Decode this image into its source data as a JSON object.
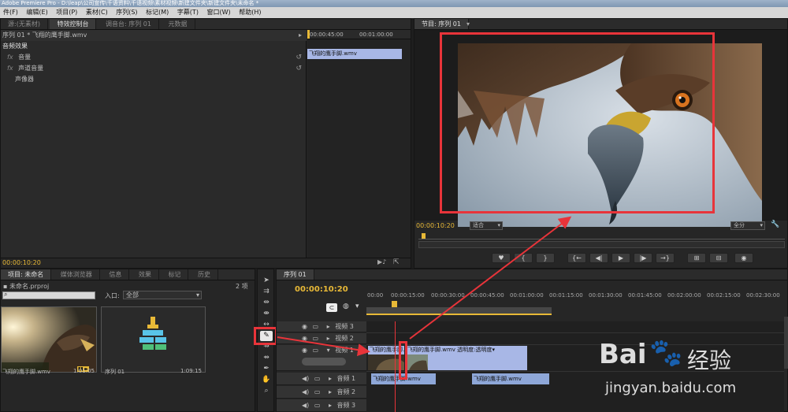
{
  "window": {
    "title": "Adobe Premiere Pro - D:\\leap\\公司宣传\\千语资料\\千语视频\\素材视频\\新建文件夹\\新建文件夹\\未命名 *"
  },
  "menu": [
    "件(F)",
    "编辑(E)",
    "项目(P)",
    "素材(C)",
    "序列(S)",
    "标记(M)",
    "字幕(T)",
    "窗口(W)",
    "帮助(H)"
  ],
  "effect_panel": {
    "tabs": [
      "源:(无素材)",
      "特效控制台",
      "调音台: 序列 01",
      "元数据"
    ],
    "active_tab": "特效控制台",
    "clip_path": "序列 01 * 飞翔的鹰手脚.wmv",
    "section": "音频效果",
    "effects": [
      "音量",
      "声道音量",
      "声像器"
    ],
    "fx_mark": "fx",
    "time_marks": [
      "00:00:45:00",
      "00:01:00:00"
    ],
    "clip_label": "飞翔的鹰手脚.wmv",
    "timecode": "00:00:10:20"
  },
  "program_panel": {
    "tab": "节目: 序列 01",
    "timecode": "00:00:10:20",
    "fit_label": "适合",
    "quality_label": "全分",
    "controls": [
      "♥",
      "{",
      "}",
      "{←",
      "◀|",
      "▶",
      "|▶",
      "→}",
      "⊞",
      "⊟",
      "◉"
    ]
  },
  "project_panel": {
    "tabs": [
      "项目: 未命名",
      "媒体浏览器",
      "信息",
      "效果",
      "标记",
      "历史"
    ],
    "project_file": "未命名.prproj",
    "item_count": "2 项",
    "in_label": "入口:",
    "in_value": "全部",
    "items": [
      {
        "name": "飞翔的鹰手脚.wmv",
        "duration": "1:01:05"
      },
      {
        "name": "序列 01",
        "duration": "1:09:15"
      }
    ]
  },
  "timeline": {
    "tab": "序列 01",
    "timecode": "00:00:10:20",
    "ruler": [
      "00:00",
      "00:00:15:00",
      "00:00:30:00",
      "00:00:45:00",
      "00:01:00:00",
      "00:01:15:00",
      "00:01:30:00",
      "00:01:45:00",
      "00:02:00:00",
      "00:02:15:00",
      "00:02:30:00"
    ],
    "video_tracks": [
      "视频 3",
      "视频 2",
      "视频 1"
    ],
    "audio_tracks": [
      "音频 1",
      "音频 2",
      "音频 3"
    ],
    "video_clips": [
      {
        "label": "飞翔的鹰手脚.wmv 透明度:透明度▾"
      },
      {
        "label": "飞翔的鹰手脚.wmv 透明度:透明度▾"
      }
    ],
    "audio_clips": [
      {
        "label": "飞翔的鹰手脚.wmv"
      },
      {
        "label": "飞翔的鹰手脚.wmv"
      }
    ]
  },
  "watermark": {
    "brand": "Bai",
    "cn": "经验",
    "url": "jingyan.baidu.com"
  },
  "colors": {
    "accent": "#e8b937",
    "annotation": "#e8343a",
    "clip_video": "#a8b7e6",
    "clip_audio": "#8ea7d8"
  }
}
